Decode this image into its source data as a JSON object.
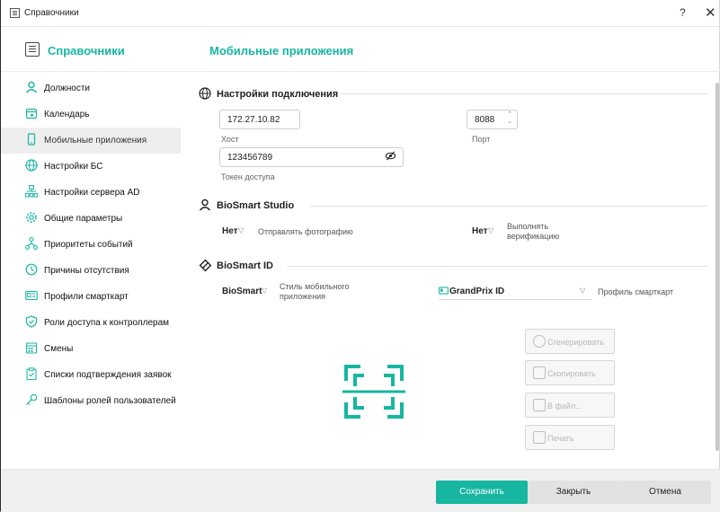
{
  "window": {
    "title": "Справочники",
    "help_label": "?",
    "close_label": "✕"
  },
  "header": {
    "section_title": "Справочники",
    "page_title": "Мобильные приложения"
  },
  "sidebar": {
    "items": [
      {
        "label": "Должности",
        "icon": "person-icon"
      },
      {
        "label": "Календарь",
        "icon": "calendar-icon"
      },
      {
        "label": "Мобильные приложения",
        "icon": "mobile-icon",
        "active": true
      },
      {
        "label": "Настройки БС",
        "icon": "globe-icon"
      },
      {
        "label": "Настройки сервера AD",
        "icon": "network-icon"
      },
      {
        "label": "Общие параметры",
        "icon": "gear-icon"
      },
      {
        "label": "Приоритеты событий",
        "icon": "hierarchy-icon"
      },
      {
        "label": "Причины отсутствия",
        "icon": "clock-icon"
      },
      {
        "label": "Профили смарткарт",
        "icon": "card-icon"
      },
      {
        "label": "Роли доступа к контроллерам",
        "icon": "shield-icon"
      },
      {
        "label": "Смены",
        "icon": "calendar-grid-icon"
      },
      {
        "label": "Списки подтверждения заявок",
        "icon": "clipboard-icon"
      },
      {
        "label": "Шаблоны ролей пользователей",
        "icon": "key-icon"
      }
    ]
  },
  "connection": {
    "title": "Настройки подключения",
    "host_value": "172.27.10.82",
    "host_label": "Хост",
    "port_value": "8088",
    "port_label": "Порт",
    "token_value": "123456789",
    "token_label": "Токен доступа"
  },
  "studio": {
    "title": "BioSmart Studio",
    "send_photo_value": "Нет",
    "send_photo_label": "Отправлять фотографию",
    "verify_value": "Нет",
    "verify_label_1": "Выполнять",
    "verify_label_2": "верификацию"
  },
  "biosmart_id": {
    "title": "BioSmart ID",
    "style_value": "BioSmart",
    "style_label_1": "Стиль мобильного",
    "style_label_2": "приложения",
    "profile_value": "GrandPrix ID",
    "profile_label": "Профиль смарткарт"
  },
  "actions": {
    "generate": "Сгенерировать",
    "copy": "Скопировать",
    "to_file": "В файл...",
    "print": "Печать"
  },
  "footer": {
    "save": "Сохранить",
    "close": "Закрыть",
    "cancel": "Отмена"
  },
  "colors": {
    "accent": "#17b6a1"
  }
}
